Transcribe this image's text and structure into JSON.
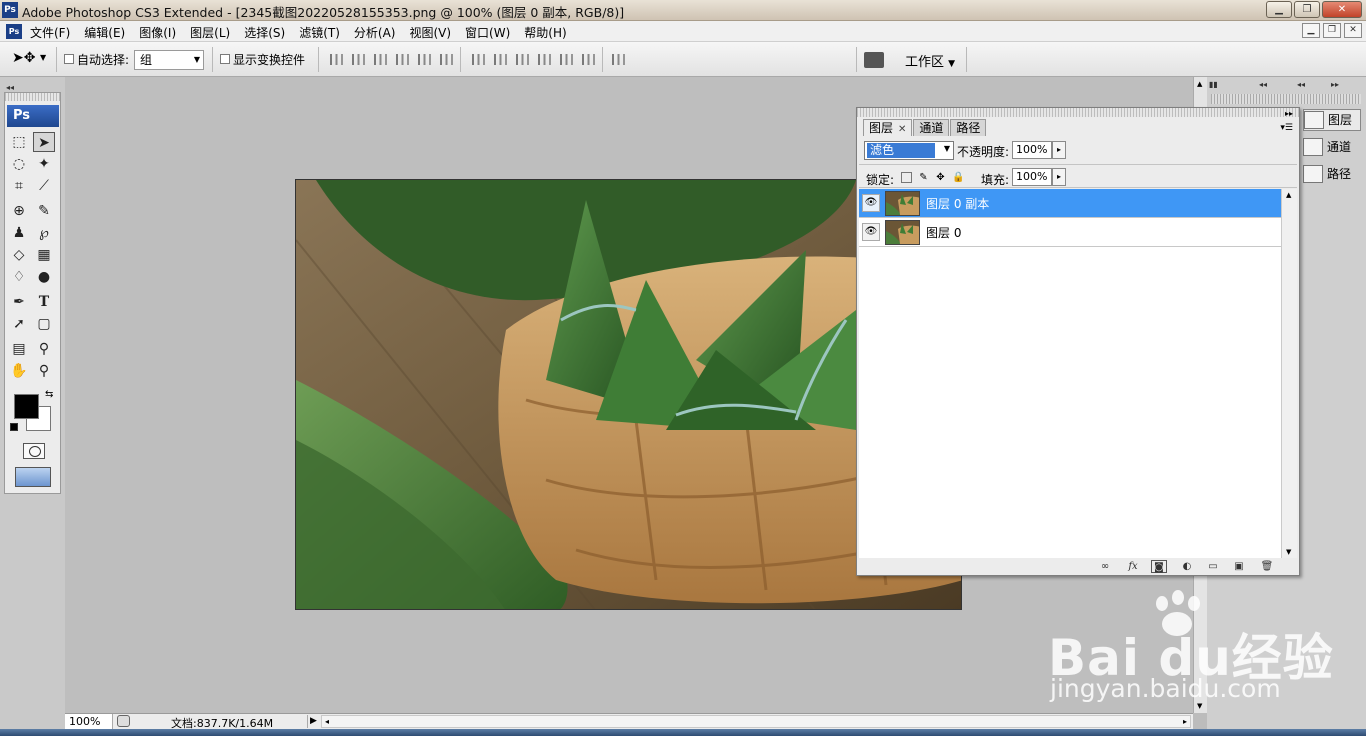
{
  "window": {
    "title": "Adobe Photoshop CS3 Extended - [2345截图20220528155353.png @ 100% (图层 0 副本, RGB/8)]",
    "app_icon": "Ps",
    "minimize_glyph": "▁",
    "maximize_glyph": "❐",
    "close_glyph": "✕"
  },
  "menubar": {
    "logo": "Ps",
    "items": [
      "文件(F)",
      "编辑(E)",
      "图像(I)",
      "图层(L)",
      "选择(S)",
      "滤镜(T)",
      "分析(A)",
      "视图(V)",
      "窗口(W)",
      "帮助(H)"
    ]
  },
  "options": {
    "auto_select_label": "自动选择:",
    "auto_select_value": "组",
    "show_transform_label": "显示变换控件",
    "workspace_label": "工作区"
  },
  "toolbox": {
    "logo": "Ps"
  },
  "dock": {
    "items": [
      {
        "label": "图层",
        "icon": "layers-icon"
      },
      {
        "label": "通道",
        "icon": "channels-icon"
      },
      {
        "label": "路径",
        "icon": "paths-icon"
      }
    ]
  },
  "layers_panel": {
    "tabs": [
      "图层",
      "通道",
      "路径"
    ],
    "blend_mode": "滤色",
    "opacity_label": "不透明度:",
    "opacity_value": "100%",
    "lock_label": "锁定:",
    "fill_label": "填充:",
    "fill_value": "100%",
    "layers": [
      {
        "name": "图层 0 副本",
        "selected": true,
        "visible": true
      },
      {
        "name": "图层 0",
        "selected": false,
        "visible": true
      }
    ]
  },
  "statusbar": {
    "zoom": "100%",
    "doc_info": "文档:837.7K/1.64M"
  },
  "watermark": {
    "brand": "Bai du经验",
    "url": "jingyan.baidu.com"
  }
}
